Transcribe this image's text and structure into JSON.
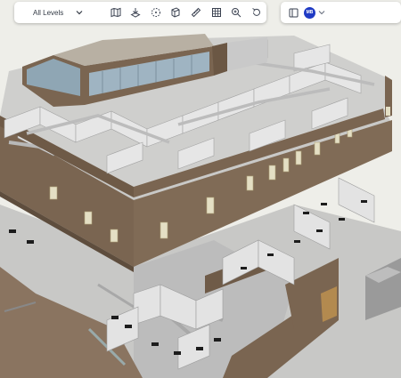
{
  "toolbar": {
    "level_selector": "All Levels",
    "tools": [
      {
        "icon": "map-icon"
      },
      {
        "icon": "section-icon"
      },
      {
        "icon": "select-region-icon"
      },
      {
        "icon": "3d-view-icon"
      },
      {
        "icon": "measure-icon"
      },
      {
        "icon": "grid-icon"
      },
      {
        "icon": "zoom-icon"
      },
      {
        "icon": "reset-view-icon"
      }
    ]
  },
  "user_bar": {
    "panel_icon": "panel-toggle-icon",
    "avatar_initials": "MB",
    "avatar_color": "#1f3ac4"
  },
  "colors": {
    "exterior_wall": "#7a6551",
    "interior_wall": "#d9d9d9",
    "floor": "#b9b9b9",
    "glass": "#9fb4c2",
    "background": "#ecece8"
  }
}
